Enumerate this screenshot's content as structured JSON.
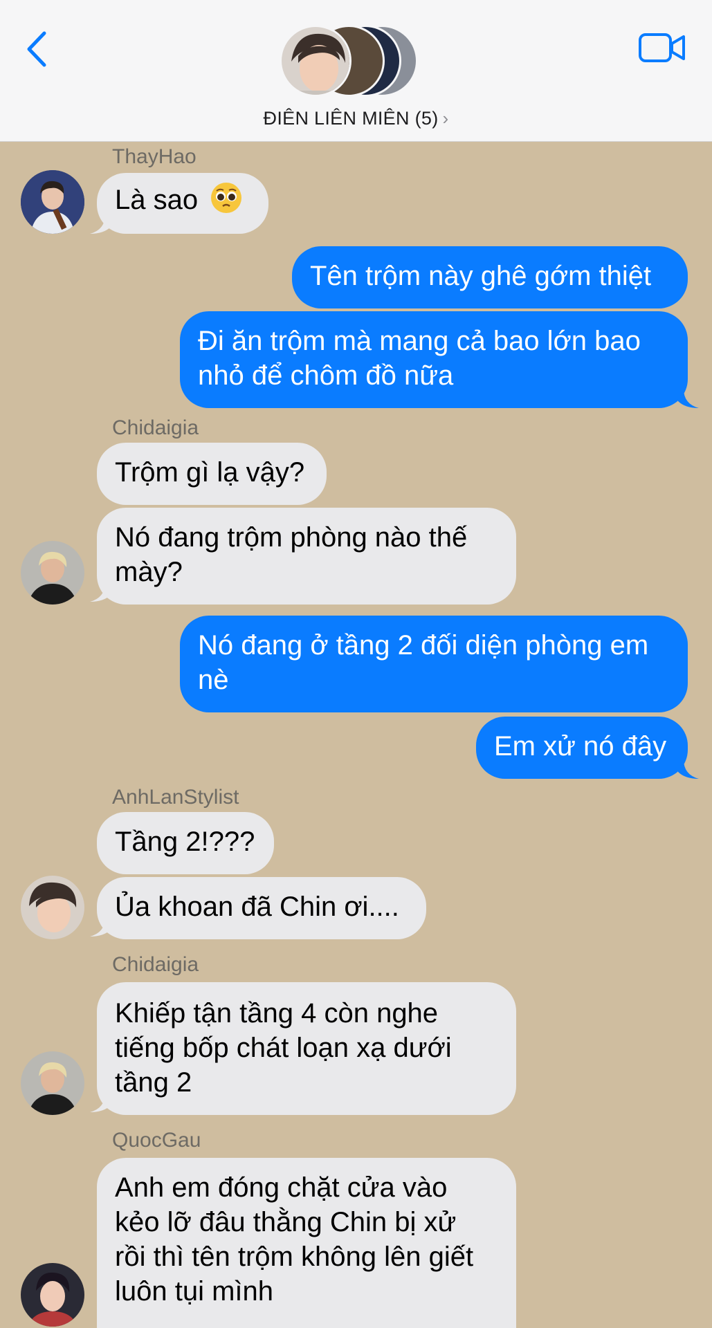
{
  "header": {
    "title": "ĐIÊN LIÊN MIÊN (5)",
    "back_icon": "chevron-left-icon",
    "video_icon": "video-camera-icon"
  },
  "colors": {
    "chat_background": "#cfbd9f",
    "outgoing_bubble": "#0a7cff",
    "incoming_bubble": "#e9e9eb",
    "accent": "#0a7cff"
  },
  "messages": [
    {
      "sender": "ThayHao",
      "text": "Là sao",
      "emoji": "pleading-face-emoji",
      "direction": "incoming"
    },
    {
      "text": "Tên trộm này ghê gớm thiệt",
      "direction": "outgoing"
    },
    {
      "text": "Đi ăn trộm mà mang cả bao lớn bao nhỏ để chôm đồ nữa",
      "direction": "outgoing"
    },
    {
      "sender": "Chidaigia",
      "text": "Trộm gì lạ vậy?",
      "direction": "incoming"
    },
    {
      "text": "Nó đang trộm phòng nào thế mày?",
      "direction": "incoming"
    },
    {
      "text": "Nó đang ở tầng 2 đối diện phòng em nè",
      "direction": "outgoing"
    },
    {
      "text": "Em xử nó đây",
      "direction": "outgoing"
    },
    {
      "sender": "AnhLanStylist",
      "text": "Tầng 2!???",
      "direction": "incoming"
    },
    {
      "text": "Ủa khoan đã Chin ơi....",
      "direction": "incoming"
    },
    {
      "sender": "Chidaigia",
      "text": "Khiếp tận tầng 4 còn nghe tiếng bốp chát loạn xạ dưới tầng 2",
      "direction": "incoming"
    },
    {
      "sender": "QuocGau",
      "text": "Anh em đóng chặt cửa vào kẻo lỡ đâu thằng Chin bị xử rồi thì tên trộm không lên giết luôn tụi mình",
      "direction": "incoming"
    }
  ]
}
